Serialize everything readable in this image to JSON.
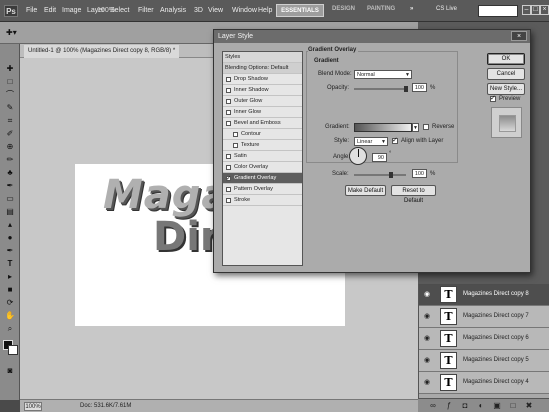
{
  "menubar": {
    "logo": "Ps",
    "items": [
      "File",
      "Edit",
      "Image",
      "Layer",
      "Select",
      "Filter",
      "Analysis",
      "3D",
      "View",
      "Window",
      "Help"
    ],
    "zoom": "100%",
    "workspaces": {
      "active": "ESSENTIALS",
      "others": [
        "DESIGN",
        "PAINTING"
      ]
    },
    "more": "»",
    "cs_live": "CS Live",
    "window_controls": [
      "–",
      "□",
      "×"
    ]
  },
  "document": {
    "tab_title": "Untitled-1 @ 100% (Magazines Direct copy 8, RGB/8) *",
    "canvas_text_line1": "Maga",
    "canvas_text_line2": "Direct"
  },
  "statusbar": {
    "zoom": "100%",
    "doc_size": "Doc: 531.6K/7.61M"
  },
  "layers": [
    {
      "name": "Magazines Direct copy 8",
      "selected": true
    },
    {
      "name": "Magazines Direct copy 7",
      "selected": false
    },
    {
      "name": "Magazines Direct copy 6",
      "selected": false
    },
    {
      "name": "Magazines Direct copy 5",
      "selected": false
    },
    {
      "name": "Magazines Direct copy 4",
      "selected": false
    }
  ],
  "dialog": {
    "title": "Layer Style",
    "close": "×",
    "styles_header": "Styles",
    "blending_options": "Blending Options: Default",
    "styles": [
      {
        "label": "Drop Shadow",
        "checked": false,
        "indent": false
      },
      {
        "label": "Inner Shadow",
        "checked": false,
        "indent": false
      },
      {
        "label": "Outer Glow",
        "checked": false,
        "indent": false
      },
      {
        "label": "Inner Glow",
        "checked": false,
        "indent": false
      },
      {
        "label": "Bevel and Emboss",
        "checked": false,
        "indent": false
      },
      {
        "label": "Contour",
        "checked": false,
        "indent": true
      },
      {
        "label": "Texture",
        "checked": false,
        "indent": true
      },
      {
        "label": "Satin",
        "checked": false,
        "indent": false
      },
      {
        "label": "Color Overlay",
        "checked": false,
        "indent": false
      },
      {
        "label": "Gradient Overlay",
        "checked": true,
        "indent": false,
        "selected": true
      },
      {
        "label": "Pattern Overlay",
        "checked": false,
        "indent": false
      },
      {
        "label": "Stroke",
        "checked": false,
        "indent": false
      }
    ],
    "gradient_overlay": {
      "section_title": "Gradient Overlay",
      "subsection_title": "Gradient",
      "blend_mode_label": "Blend Mode:",
      "blend_mode_value": "Normal",
      "opacity_label": "Opacity:",
      "opacity_value": "100",
      "opacity_fraction": 1.0,
      "percent": "%",
      "gradient_label": "Gradient:",
      "reverse_label": "Reverse",
      "reverse_checked": false,
      "style_label": "Style:",
      "style_value": "Linear",
      "align_label": "Align with Layer",
      "align_checked": true,
      "angle_label": "Angle:",
      "angle_value": "90",
      "degree": "°",
      "scale_label": "Scale:",
      "scale_value": "100",
      "scale_fraction": 0.7,
      "make_default": "Make Default",
      "reset_default": "Reset to Default"
    },
    "buttons": {
      "ok": "OK",
      "cancel": "Cancel",
      "new_style": "New Style...",
      "preview_label": "Preview",
      "preview_checked": true
    }
  }
}
